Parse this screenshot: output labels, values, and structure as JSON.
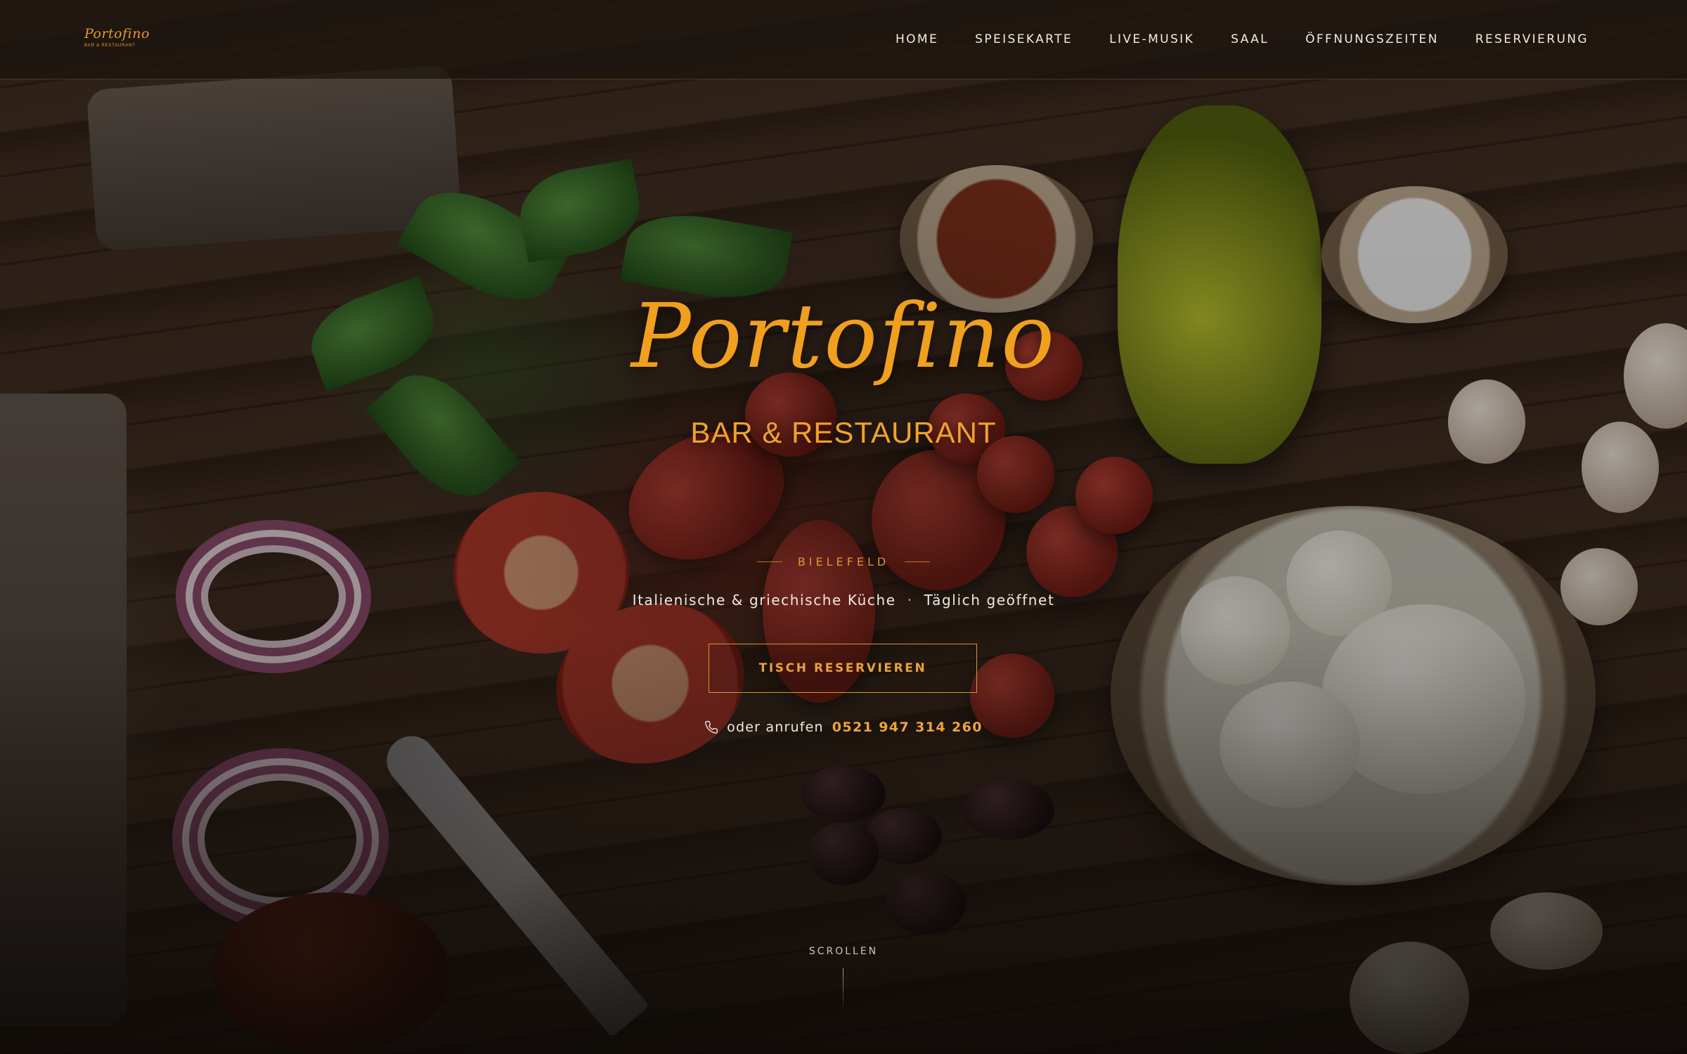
{
  "header": {
    "logo_script": "Portofino",
    "logo_sub": "BAR & RESTAURANT",
    "nav": [
      {
        "label": "HOME"
      },
      {
        "label": "SPEISEKARTE"
      },
      {
        "label": "LIVE-MUSIK"
      },
      {
        "label": "SAAL"
      },
      {
        "label": "ÖFFNUNGSZEITEN"
      },
      {
        "label": "RESERVIERUNG"
      }
    ]
  },
  "hero": {
    "title": "Portofino",
    "subtitle": "BAR & RESTAURANT",
    "city": "BIELEFELD",
    "tagline_left": "Italienische & griechische Küche",
    "tagline_sep": "·",
    "tagline_right": "Täglich geöffnet",
    "cta_label": "TISCH RESERVIEREN",
    "call_text": "oder anrufen",
    "phone": "0521 947 314 260",
    "scroll_label": "SCROLLEN"
  },
  "colors": {
    "accent": "#F0A01E",
    "nav_text": "#F1ECE4",
    "header_bg": "#1C140F"
  },
  "icons": {
    "phone": "phone-icon"
  }
}
